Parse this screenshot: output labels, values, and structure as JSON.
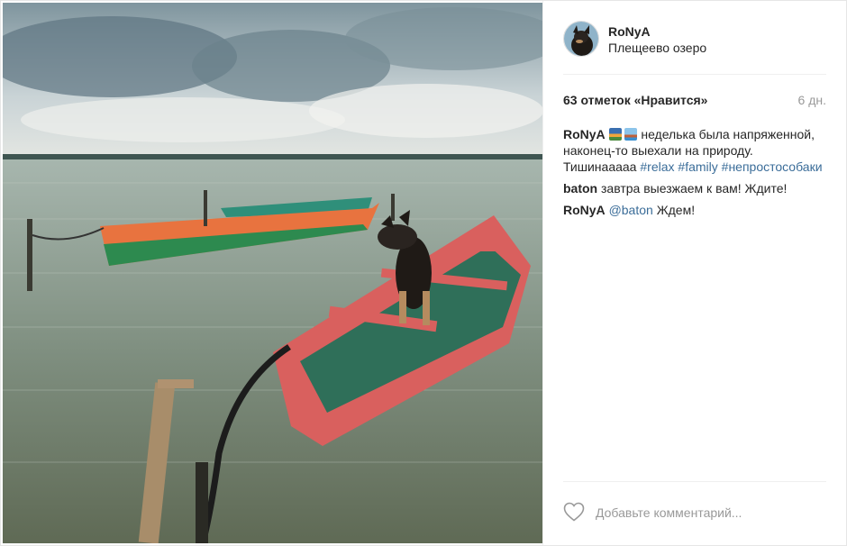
{
  "post": {
    "username": "RoNyA",
    "location": "Плещеево озеро",
    "likes_text": "63 отметок «Нравится»",
    "time_ago": "6 дн.",
    "caption": {
      "author": "RoNyA",
      "emoji_1": "sunrise-emoji",
      "emoji_2": "rowboat-emoji",
      "text": "неделька была напряженной, наконец-то выехали на природу. Тишинааааа",
      "tags": [
        "#relax",
        "#family",
        "#непростособаки"
      ]
    },
    "comments": [
      {
        "author": "baton",
        "text": "завтра выезжаем к вам! Ждите!"
      },
      {
        "author": "RoNyA",
        "mention": "@baton",
        "text": "Ждем!"
      }
    ],
    "comment_placeholder": "Добавьте комментарий...",
    "icons": {
      "like": "heart-outline-icon"
    },
    "colors": {
      "link": "#3b6d99",
      "text": "#262626",
      "muted": "#999999"
    }
  }
}
